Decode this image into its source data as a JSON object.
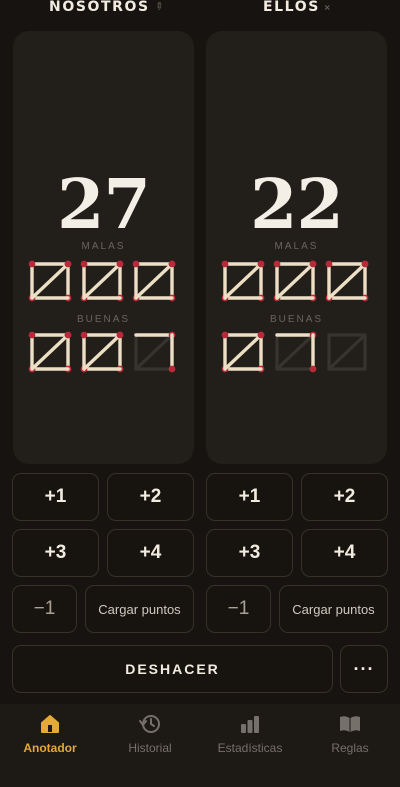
{
  "teams": [
    {
      "name": "NOSOTROS",
      "score": "27",
      "malas_label": "MALAS",
      "buenas_label": "BUENAS",
      "malas_filled_sticks": [
        5,
        5,
        5
      ],
      "buenas_filled_sticks": [
        5,
        5,
        2
      ]
    },
    {
      "name": "ELLOS",
      "score": "22",
      "malas_label": "MALAS",
      "buenas_label": "BUENAS",
      "malas_filled_sticks": [
        5,
        5,
        5
      ],
      "buenas_filled_sticks": [
        5,
        2,
        0
      ]
    }
  ],
  "controls": {
    "plus1": "+1",
    "plus2": "+2",
    "plus3": "+3",
    "plus4": "+4",
    "minus1": "−1",
    "cargar": "Cargar puntos",
    "deshacer": "DESHACER",
    "more": "···"
  },
  "tabs": [
    {
      "label": "Anotador",
      "icon": "home-icon",
      "active": true
    },
    {
      "label": "Historial",
      "icon": "history-icon",
      "active": false
    },
    {
      "label": "Estadísticas",
      "icon": "bar-chart-icon",
      "active": false
    },
    {
      "label": "Reglas",
      "icon": "book-icon",
      "active": false
    }
  ],
  "colors": {
    "accent": "#e3a93a",
    "match_head": "#b8293a",
    "match_stick": "#ecdfc5",
    "background": "#161310",
    "panel": "#221e19"
  }
}
